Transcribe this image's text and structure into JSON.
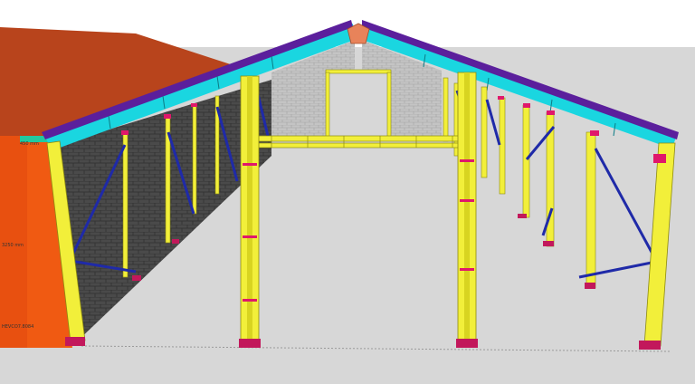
{
  "scene": {
    "description_kind": "3d-model-render",
    "colors": {
      "sky": "#ffffff",
      "ground": "#d6d6d6",
      "roof_side": "#b8441c",
      "wall_side": "#f05a12",
      "purlin": "#5b1f9c",
      "roof_sheet": "#1ad6e0",
      "column": "#f2ef3a",
      "brace": "#1f2aa8",
      "brick": "#444444",
      "gable_brick": "#bdbdbd",
      "connector": "#e0176b",
      "base_plate": "#c2185b",
      "ridge_block": "#e8835a"
    }
  },
  "dimensions": {
    "top": "450 mm",
    "mid": "3250 mm",
    "bottom": "HEVCO7.8084"
  }
}
